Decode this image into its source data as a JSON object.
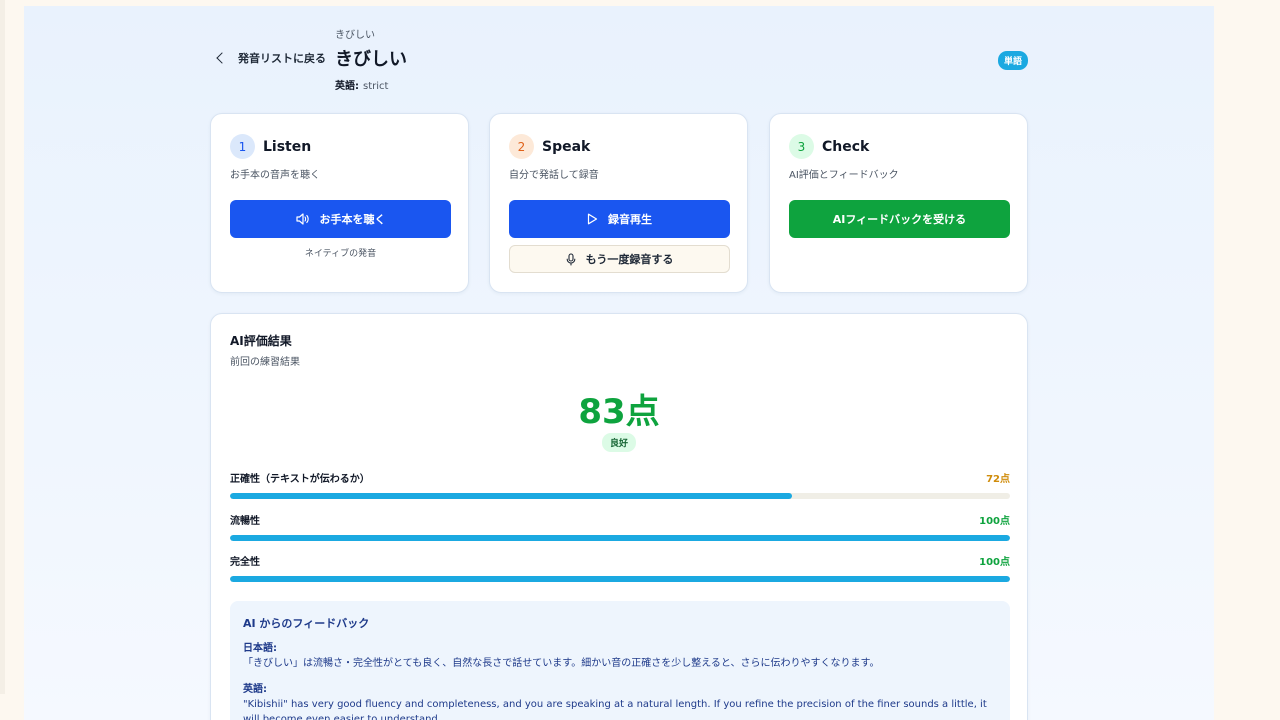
{
  "header": {
    "back_label": "発音リストに戻る",
    "reading": "きびしい",
    "word": "きびしい",
    "english_label": "英語:",
    "english_value": "strict",
    "type_badge": "単語"
  },
  "steps": [
    {
      "number": "1",
      "title": "Listen",
      "desc": "お手本の音声を聴く",
      "button": "お手本を聴く",
      "caption": "ネイティブの発音"
    },
    {
      "number": "2",
      "title": "Speak",
      "desc": "自分で発話して録音",
      "button": "録音再生",
      "secondary_button": "もう一度録音する"
    },
    {
      "number": "3",
      "title": "Check",
      "desc": "AI評価とフィードバック",
      "button": "AIフィードバックを受ける"
    }
  ],
  "results": {
    "title": "AI評価結果",
    "subtitle": "前回の練習結果",
    "score": "83点",
    "grade": "良好",
    "metrics": [
      {
        "label": "正確性（テキストが伝わるか）",
        "value": "72点",
        "percent": 72,
        "color": "#d08c0b"
      },
      {
        "label": "流暢性",
        "value": "100点",
        "percent": 100,
        "color": "#0ea33e"
      },
      {
        "label": "完全性",
        "value": "100点",
        "percent": 100,
        "color": "#0ea33e"
      }
    ],
    "feedback": {
      "title": "AI からのフィードバック",
      "ja_label": "日本語:",
      "ja_text": "「きびしい」は流暢さ・完全性がとても良く、自然な長さで話せています。細かい音の正確さを少し整えると、さらに伝わりやすくなります。",
      "en_label": "英語:",
      "en_text": "\"Kibishii\" has very good fluency and completeness, and you are speaking at a natural length. If you refine the precision of the finer sounds a little, it will become even easier to understand."
    }
  },
  "colors": {
    "primary": "#1a56f0",
    "success": "#0ea33e",
    "accent": "#1ba9e1",
    "warning": "#d08c0b"
  }
}
